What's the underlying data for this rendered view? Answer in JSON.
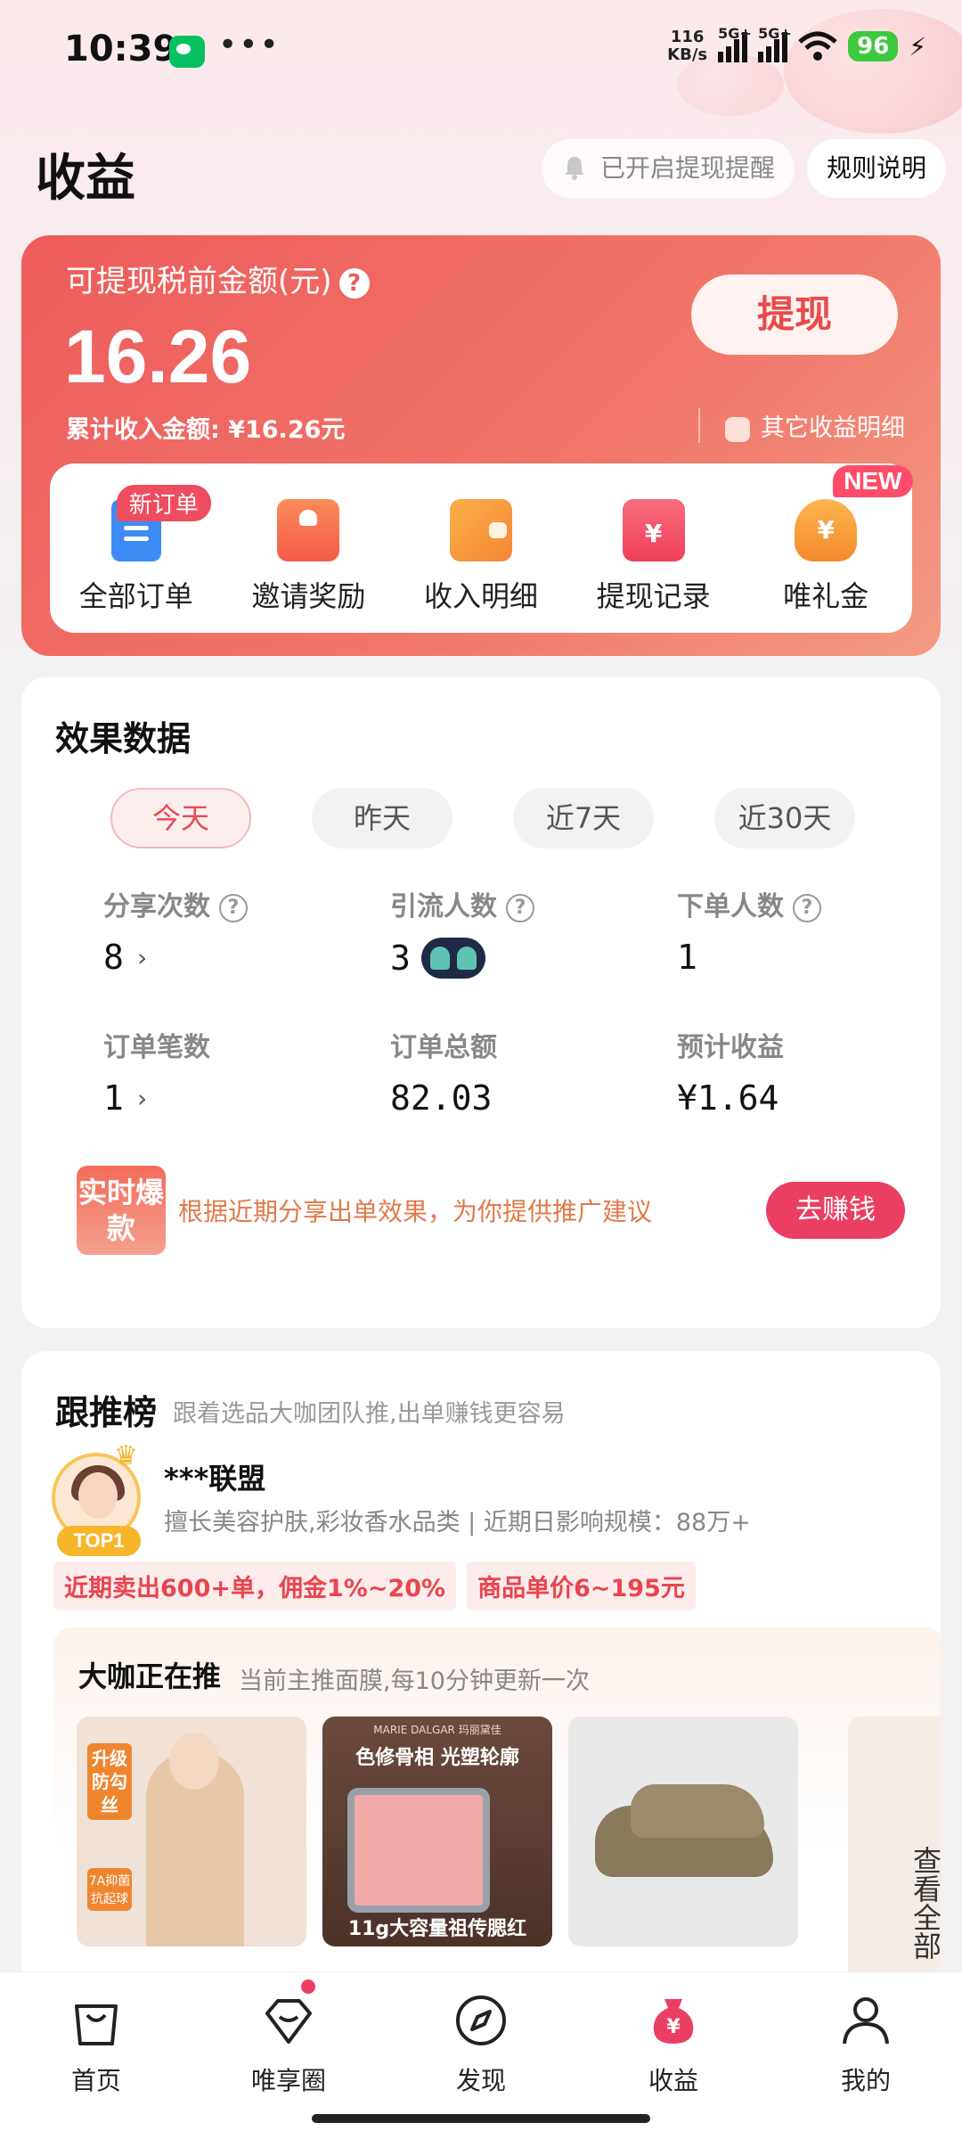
{
  "status_bar": {
    "time": "10:39",
    "net_speed_value": "116",
    "net_speed_unit": "KB/s",
    "signal1_label": "5G+",
    "signal2_label": "5G+",
    "battery": "96"
  },
  "header": {
    "title": "收益",
    "remind_label": "已开启提现提醒",
    "rules_label": "规则说明"
  },
  "earnings": {
    "label": "可提现税前金额(元)",
    "help_glyph": "?",
    "amount": "16.26",
    "withdraw_label": "提现",
    "total_income": "累计收入金额: ¥16.26元",
    "other_detail": "其它收益明细"
  },
  "quick_actions": [
    {
      "label": "全部订单",
      "badge": "新订单"
    },
    {
      "label": "邀请奖励"
    },
    {
      "label": "收入明细"
    },
    {
      "label": "提现记录"
    },
    {
      "label": "唯礼金",
      "badge": "NEW"
    }
  ],
  "effect": {
    "title": "效果数据",
    "tabs": [
      "今天",
      "昨天",
      "近7天",
      "近30天"
    ],
    "active_tab": "今天",
    "metrics": [
      {
        "label": "分享次数",
        "value": "8"
      },
      {
        "label": "引流人数",
        "value": "3"
      },
      {
        "label": "下单人数",
        "value": "1"
      },
      {
        "label": "订单笔数",
        "value": "1"
      },
      {
        "label": "订单总额",
        "value": "82.03"
      },
      {
        "label": "预计收益",
        "value": "¥1.64"
      }
    ],
    "hot_badge": "实时爆款",
    "hot_text": "根据近期分享出单效果，为你提供推广建议",
    "earn_button": "去赚钱",
    "help_glyph": "?",
    "chevron": "›"
  },
  "recommend": {
    "title": "跟推榜",
    "subtitle": "跟着选品大咖团队推,出单赚钱更容易",
    "rank_label": "TOP1",
    "kol_name": "***联盟",
    "kol_desc": "擅长美容护肤,彩妆香水品类  |  近期日影响规模：88万+",
    "tags": [
      "近期卖出600+单，佣金1%~20%",
      "商品单价6~195元"
    ],
    "hot_push_title": "大咖正在推",
    "hot_push_sub": "当前主推面膜,每10分钟更新一次",
    "view_all": "查看全部",
    "products": [
      {
        "top_label": "升级防勾丝",
        "bottom_label": "7A抑菌抗起球"
      },
      {
        "brand": "MARIE DALGAR 玛丽黛佳",
        "headline": "色修骨相 光塑轮廓",
        "caption": "11g大容量祖传腮红"
      },
      {}
    ]
  },
  "bottom_nav": [
    {
      "label": "首页",
      "icon": "bag-icon"
    },
    {
      "label": "唯享圈",
      "icon": "diamond-icon",
      "dot": true
    },
    {
      "label": "发现",
      "icon": "compass-icon"
    },
    {
      "label": "收益",
      "icon": "money-bag-icon",
      "active": true
    },
    {
      "label": "我的",
      "icon": "user-icon"
    }
  ],
  "colors": {
    "accent": "#ea3f62",
    "card_gradient_start": "#ee5b5b",
    "card_gradient_end": "#f39a83"
  }
}
